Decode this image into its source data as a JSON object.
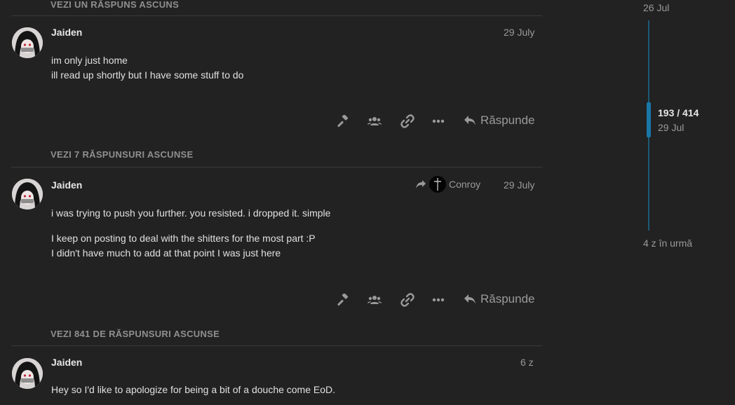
{
  "hidden_gaps": [
    "VEZI UN RĂSPUNS ASCUNS",
    "VEZI 7 RĂSPUNSURI ASCUNSE",
    "VEZI 841 DE RĂSPUNSURI ASCUNSE"
  ],
  "posts": [
    {
      "username": "Jaiden",
      "date": "29 July",
      "paragraphs": [
        "im only just home\nill read up shortly but I have some stuff to do"
      ],
      "reply_label": "Răspunde"
    },
    {
      "username": "Jaiden",
      "reply_to": "Conroy",
      "date": "29 July",
      "paragraphs": [
        "i was trying to push you further. you resisted. i dropped it. simple",
        "I keep on posting to deal with the shitters for the most part :P\nI didn't have much to add at that point I was just here"
      ],
      "reply_label": "Răspunde"
    },
    {
      "username": "Jaiden",
      "date": "6 z",
      "paragraphs": [
        "Hey so I'd like to apologize for being a bit of a douche come EoD."
      ]
    }
  ],
  "action_icons": [
    "gavel-icon",
    "users-icon",
    "link-icon",
    "ellipsis-icon",
    "reply-icon"
  ],
  "timeline": {
    "top_date": "26 Jul",
    "position": "193 / 414",
    "current_date": "29 Jul",
    "bottom_label": "4 z în urmă"
  },
  "colors": {
    "background": "#222222",
    "text": "#dddddd",
    "muted": "#9a9a9a",
    "timeline_accent": "#1a78a8"
  }
}
